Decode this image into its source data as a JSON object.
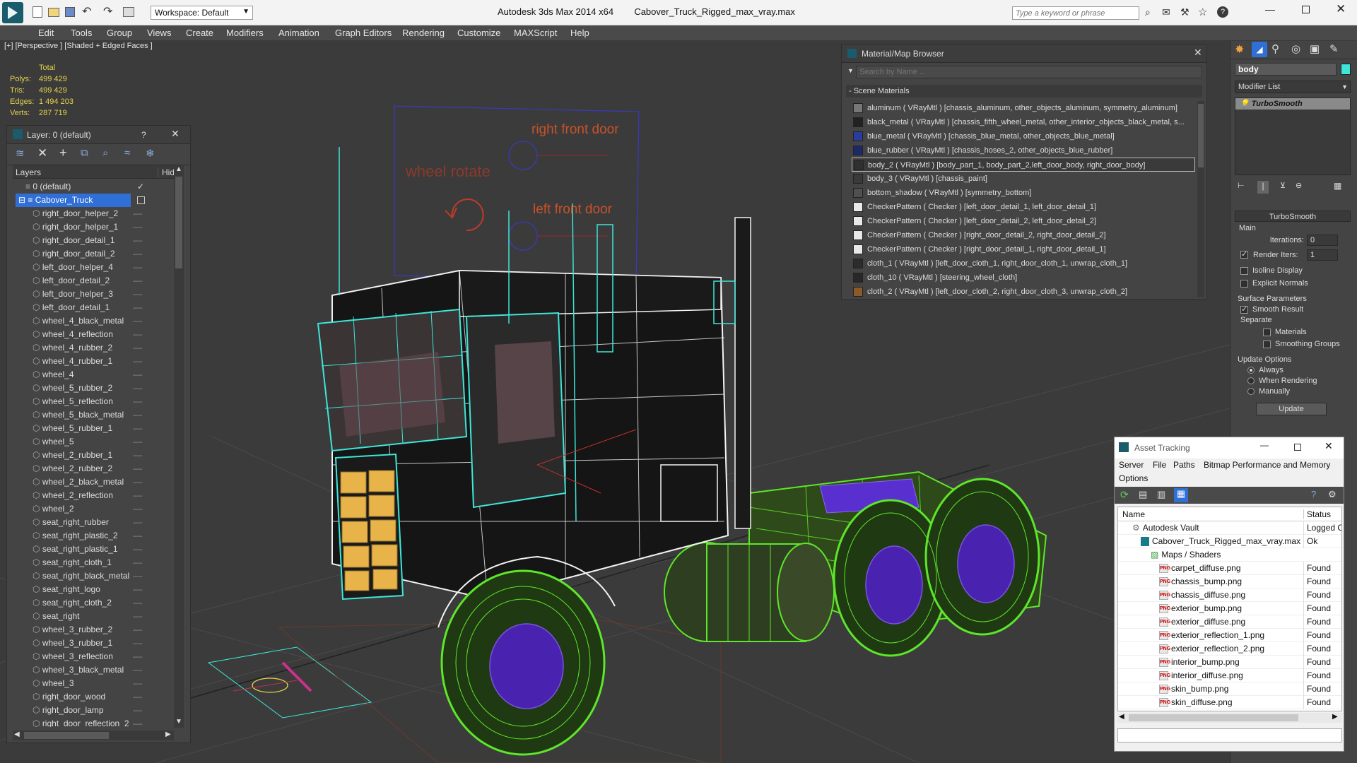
{
  "title_bar": {
    "app_title": "Autodesk 3ds Max  2014 x64",
    "file_name": "Cabover_Truck_Rigged_max_vray.max",
    "workspace_label": "Workspace: Default",
    "search_placeholder": "Type a keyword or phrase"
  },
  "menu": [
    "Edit",
    "Tools",
    "Group",
    "Views",
    "Create",
    "Modifiers",
    "Animation",
    "Graph Editors",
    "Rendering",
    "Customize",
    "MAXScript",
    "Help"
  ],
  "viewport": {
    "label": "[+] [Perspective ] [Shaded + Edged Faces ]",
    "stats": {
      "header": "Total",
      "rows": [
        {
          "label": "Polys:",
          "value": "499 429"
        },
        {
          "label": "Tris:",
          "value": "499 429"
        },
        {
          "label": "Edges:",
          "value": "1 494 203"
        },
        {
          "label": "Verts:",
          "value": "287 719"
        }
      ]
    },
    "rig_labels": {
      "right_front_door": "right front door",
      "wheel_rotate": "wheel rotate",
      "left_front_door": "left front door"
    }
  },
  "layer_panel": {
    "title": "Layer: 0 (default)",
    "help": "?",
    "col_layers": "Layers",
    "col_hide": "Hide",
    "default_layer": "0 (default)",
    "selected_layer": "Cabover_Truck",
    "items": [
      "right_door_helper_2",
      "right_door_helper_1",
      "right_door_detail_1",
      "right_door_detail_2",
      "left_door_helper_4",
      "left_door_detail_2",
      "left_door_helper_3",
      "left_door_detail_1",
      "wheel_4_black_metal",
      "wheel_4_reflection",
      "wheel_4_rubber_2",
      "wheel_4_rubber_1",
      "wheel_4",
      "wheel_5_rubber_2",
      "wheel_5_reflection",
      "wheel_5_black_metal",
      "wheel_5_rubber_1",
      "wheel_5",
      "wheel_2_rubber_1",
      "wheel_2_rubber_2",
      "wheel_2_black_metal",
      "wheel_2_reflection",
      "wheel_2",
      "seat_right_rubber",
      "seat_right_plastic_2",
      "seat_right_plastic_1",
      "seat_right_cloth_1",
      "seat_right_black_metal",
      "seat_right_logo",
      "seat_right_cloth_2",
      "seat_right",
      "wheel_3_rubber_2",
      "wheel_3_rubber_1",
      "wheel_3_reflection",
      "wheel_3_black_metal",
      "wheel_3",
      "right_door_wood",
      "right_door_lamp",
      "right_door_reflection_2"
    ]
  },
  "material_browser": {
    "title": "Material/Map Browser",
    "search_placeholder": "Search by Name ...",
    "section": "- Scene Materials",
    "items": [
      {
        "text": "aluminum  ( VRayMtl ) [chassis_aluminum, other_objects_aluminum, symmetry_aluminum]",
        "swatch": "#777777"
      },
      {
        "text": "black_metal  ( VRayMtl ) [chassis_fifth_wheel_metal, other_interior_objects_black_metal, s...",
        "swatch": "#222222"
      },
      {
        "text": "blue_metal  ( VRayMtl ) [chassis_blue_metal, other_objects_blue_metal]",
        "swatch": "#2a3c9c"
      },
      {
        "text": "blue_rubber  ( VRayMtl ) [chassis_hoses_2, other_objects_blue_rubber]",
        "swatch": "#1d2a6a"
      },
      {
        "text": "body_2  ( VRayMtl ) [body_part_1, body_part_2,left_door_body, right_door_body]",
        "swatch": "#303030"
      },
      {
        "text": "body_3  ( VRayMtl ) [chassis_paint]",
        "swatch": "#3a3a3a"
      },
      {
        "text": "bottom_shadow  ( VRayMtl ) [symmetry_bottom]",
        "swatch": "#505050"
      },
      {
        "text": "CheckerPattern  ( Checker ) [left_door_detail_1, left_door_detail_1]",
        "swatch": "#e8e8e8"
      },
      {
        "text": "CheckerPattern  ( Checker ) [left_door_detail_2, left_door_detail_2]",
        "swatch": "#e8e8e8"
      },
      {
        "text": "CheckerPattern  ( Checker ) [right_door_detail_2, right_door_detail_2]",
        "swatch": "#e8e8e8"
      },
      {
        "text": "CheckerPattern  ( Checker ) [right_door_detail_1, right_door_detail_1]",
        "swatch": "#e8e8e8"
      },
      {
        "text": "cloth_1  ( VRayMtl ) [left_door_cloth_1, right_door_cloth_1, unwrap_cloth_1]",
        "swatch": "#2c2c2c"
      },
      {
        "text": "cloth_10  ( VRayMtl ) [steering_wheel_cloth]",
        "swatch": "#282828"
      },
      {
        "text": "cloth_2  ( VRayMtl ) [left_door_cloth_2, right_door_cloth_3, unwrap_cloth_2]",
        "swatch": "#8a5a2a"
      }
    ]
  },
  "command_panel": {
    "object_name": "body",
    "modifier_list": "Modifier List",
    "stack_item": "TurboSmooth",
    "rollout_title": "TurboSmooth",
    "main": "Main",
    "iterations_label": "Iterations:",
    "iterations_value": "0",
    "render_iters_label": "Render Iters:",
    "render_iters_value": "1",
    "isoline": "Isoline Display",
    "explicit_normals": "Explicit Normals",
    "surface_params": "Surface Parameters",
    "smooth_result": "Smooth Result",
    "separate": "Separate",
    "materials": "Materials",
    "smoothing_groups": "Smoothing Groups",
    "update_options": "Update Options",
    "always": "Always",
    "when_rendering": "When Rendering",
    "manually": "Manually",
    "update_button": "Update"
  },
  "asset_tracking": {
    "title": "Asset Tracking",
    "menu": [
      "Server",
      "File",
      "Paths",
      "Bitmap Performance and Memory"
    ],
    "menu2": "Options",
    "col_name": "Name",
    "col_status": "Status",
    "rows": [
      {
        "name": "Autodesk Vault",
        "status": "Logged C",
        "level": 1,
        "icon": "vault"
      },
      {
        "name": "Cabover_Truck_Rigged_max_vray.max",
        "status": "Ok",
        "level": 2,
        "icon": "max"
      },
      {
        "name": "Maps / Shaders",
        "status": "",
        "level": 3,
        "icon": "maps"
      },
      {
        "name": "carpet_diffuse.png",
        "status": "Found",
        "level": 4,
        "icon": "png"
      },
      {
        "name": "chassis_bump.png",
        "status": "Found",
        "level": 4,
        "icon": "png"
      },
      {
        "name": "chassis_diffuse.png",
        "status": "Found",
        "level": 4,
        "icon": "png"
      },
      {
        "name": "exterior_bump.png",
        "status": "Found",
        "level": 4,
        "icon": "png"
      },
      {
        "name": "exterior_diffuse.png",
        "status": "Found",
        "level": 4,
        "icon": "png"
      },
      {
        "name": "exterior_reflection_1.png",
        "status": "Found",
        "level": 4,
        "icon": "png"
      },
      {
        "name": "exterior_reflection_2.png",
        "status": "Found",
        "level": 4,
        "icon": "png"
      },
      {
        "name": "interior_bump.png",
        "status": "Found",
        "level": 4,
        "icon": "png"
      },
      {
        "name": "interior_diffuse.png",
        "status": "Found",
        "level": 4,
        "icon": "png"
      },
      {
        "name": "skin_bump.png",
        "status": "Found",
        "level": 4,
        "icon": "png"
      },
      {
        "name": "skin_diffuse.png",
        "status": "Found",
        "level": 4,
        "icon": "png"
      }
    ]
  },
  "colors": {
    "wire_cyan": "#3ee6d8",
    "wire_green": "#5ee62a",
    "wire_white": "#f2f2f2",
    "wire_purple": "#5a2fd0",
    "grille_yellow": "#e8b44a",
    "rig_label": "#c8522a",
    "stats_yellow": "#e8d24a",
    "selection_blue": "#2f6fd6"
  }
}
